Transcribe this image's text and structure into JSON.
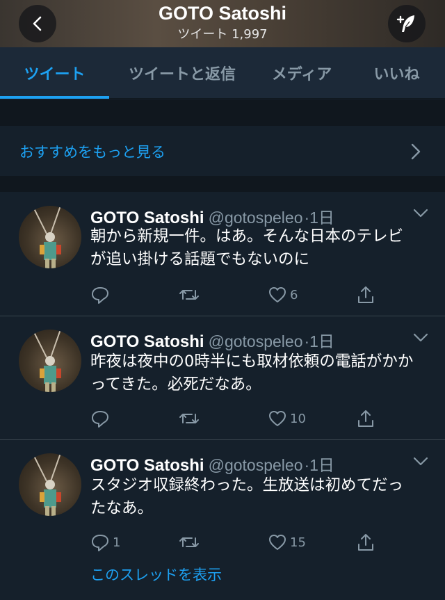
{
  "header": {
    "title": "GOTO Satoshi",
    "subtitle": "ツイート 1,997"
  },
  "tabs": [
    {
      "label": "ツイート"
    },
    {
      "label": "ツイートと返信"
    },
    {
      "label": "メディア"
    },
    {
      "label": "いいね"
    }
  ],
  "more": {
    "label": "おすすめをもっと見る"
  },
  "tweets": [
    {
      "name": "GOTO Satoshi",
      "handle": "@gotospeleo",
      "time": "·1日",
      "text": "朝から新規一件。はあ。そんな日本のテレビが追い掛ける話題でもないのに",
      "reply_count": "",
      "like_count": "6"
    },
    {
      "name": "GOTO Satoshi",
      "handle": "@gotospeleo",
      "time": "·1日",
      "text": "昨夜は夜中の0時半にも取材依頼の電話がかかってきた。必死だなあ。",
      "reply_count": "",
      "like_count": "10"
    },
    {
      "name": "GOTO Satoshi",
      "handle": "@gotospeleo",
      "time": "·1日",
      "text": "スタジオ収録終わった。生放送は初めてだったなあ。",
      "reply_count": "1",
      "like_count": "15",
      "thread_link": "このスレッドを表示"
    }
  ]
}
